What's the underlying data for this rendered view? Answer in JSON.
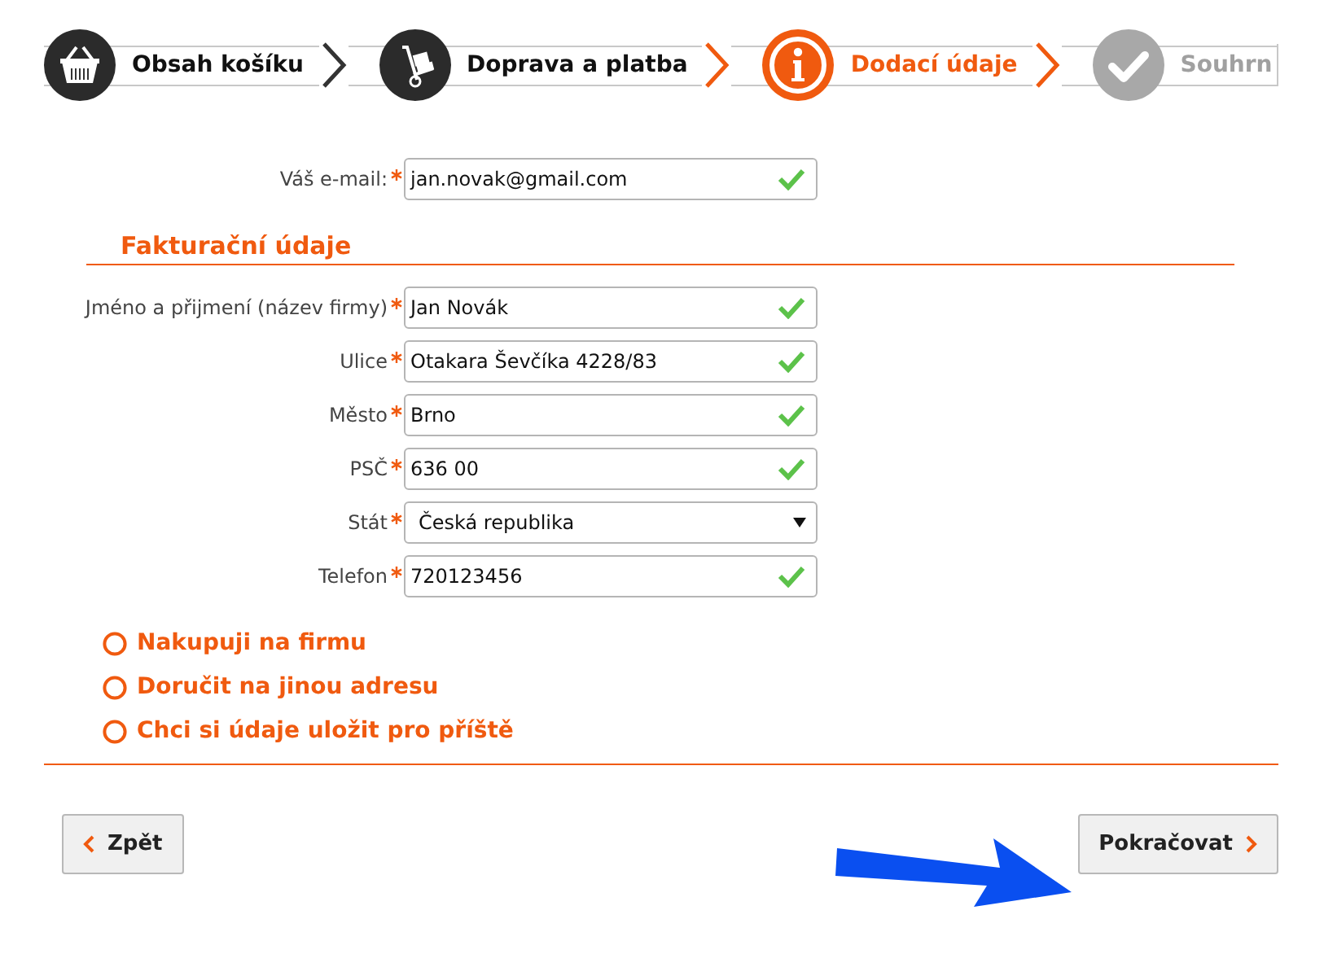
{
  "steps": [
    {
      "label": "Obsah košíku",
      "completed": true,
      "selected": false,
      "kind": "basket"
    },
    {
      "label": "Doprava a platba",
      "completed": true,
      "selected": false,
      "kind": "trolley"
    },
    {
      "label": "Dodací údaje",
      "completed": false,
      "selected": true,
      "kind": "info"
    },
    {
      "label": "Souhrn",
      "completed": false,
      "selected": false,
      "kind": "check"
    }
  ],
  "email": {
    "label": "Váš e-mail:",
    "required": true,
    "value": "jan.novak@gmail.com",
    "valid": true,
    "kind": "text"
  },
  "billing": {
    "title": "Fakturační údaje",
    "fields": [
      {
        "label": "Jméno a přijmení (název firmy)",
        "required": true,
        "value": "Jan Novák",
        "valid": true,
        "kind": "text"
      },
      {
        "label": "Ulice",
        "required": true,
        "value": "Otakara Ševčíka 4228/83",
        "valid": true,
        "kind": "text"
      },
      {
        "label": "Město",
        "required": true,
        "value": "Brno",
        "valid": true,
        "kind": "text"
      },
      {
        "label": "PSČ",
        "required": true,
        "value": "636 00",
        "valid": true,
        "kind": "text"
      },
      {
        "label": "Stát",
        "required": true,
        "value": "Česká republika",
        "kind": "select"
      },
      {
        "label": "Telefon",
        "required": true,
        "value": "720123456",
        "valid": true,
        "kind": "text"
      }
    ]
  },
  "options": [
    {
      "label": "Nakupuji na firmu",
      "checked": false
    },
    {
      "label": "Doručit na jinou adresu",
      "checked": false
    },
    {
      "label": "Chci si údaje uložit pro příště",
      "checked": false
    }
  ],
  "back_button": {
    "label": "Zpět"
  },
  "continue_button": {
    "label": "Pokračovat"
  }
}
